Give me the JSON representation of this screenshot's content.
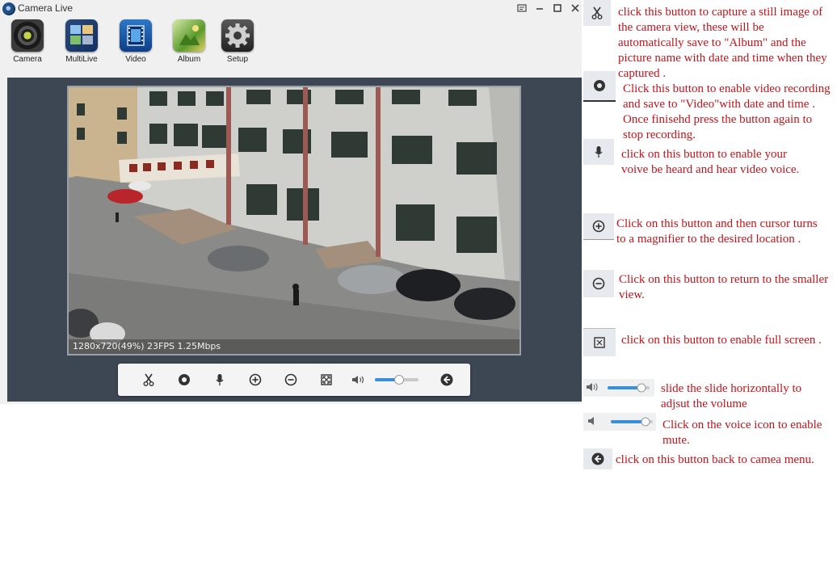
{
  "window": {
    "title": "Camera Live"
  },
  "toolbar": {
    "items": [
      {
        "label": "Camera"
      },
      {
        "label": "MultiLive"
      },
      {
        "label": "Video"
      },
      {
        "label": "Album"
      },
      {
        "label": "Setup"
      }
    ]
  },
  "video": {
    "status": "1280x720(49%)  23FPS 1.25Mbps"
  },
  "controls": {
    "volume_level": 0.55
  },
  "annotations": {
    "capture": "click this button to capture a still image of the camera view, these will be automatically save to \"Album\" and the picture name with date and time when they captured .",
    "record": "Click this button to enable video recording and save to \"Video\"with date and time . Once finisehd press the button again to stop recording.",
    "voice": "click on this button to enable your voive be heard and hear video voice.",
    "zoom_in": "Click on this button and then cursor turns to a magnifier to the desired location .",
    "zoom_out": "Click on this button to return to the smaller view.",
    "fullscreen": "click on this button to enable full screen .",
    "volume": "slide the slide horizontally to adjsut the volume",
    "mute": "Click on the voice icon  to enable mute.",
    "back": "click on this button back to camea menu."
  },
  "colors": {
    "annotation": "#c0151c",
    "panel": "#3d4653",
    "slider_fill": "#3b8fd8"
  }
}
